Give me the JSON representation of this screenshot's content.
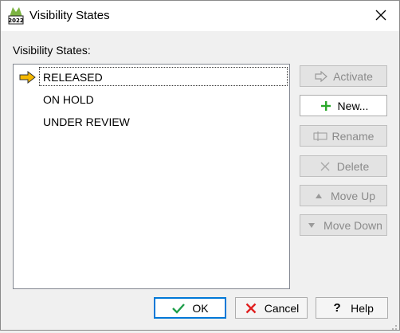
{
  "window": {
    "title": "Visibility States",
    "app_icon": "app-2022-icon",
    "close_icon": "close-icon"
  },
  "section_label": "Visibility States:",
  "states": [
    {
      "label": "RELEASED",
      "active": true,
      "selected": true
    },
    {
      "label": "ON HOLD",
      "active": false,
      "selected": false
    },
    {
      "label": "UNDER REVIEW",
      "active": false,
      "selected": false
    }
  ],
  "side_buttons": {
    "activate": {
      "label": "Activate",
      "icon": "arrow-right-icon",
      "enabled": false
    },
    "new": {
      "label": "New...",
      "icon": "plus-icon",
      "enabled": true
    },
    "rename": {
      "label": "Rename",
      "icon": "rename-icon",
      "enabled": false
    },
    "delete": {
      "label": "Delete",
      "icon": "x-icon",
      "enabled": false
    },
    "move_up": {
      "label": "Move Up",
      "icon": "triangle-up-icon",
      "enabled": false
    },
    "move_down": {
      "label": "Move Down",
      "icon": "triangle-down-icon",
      "enabled": false
    }
  },
  "footer_buttons": {
    "ok": {
      "label": "OK",
      "icon": "checkmark-icon"
    },
    "cancel": {
      "label": "Cancel",
      "icon": "x-icon"
    },
    "help": {
      "label": "Help",
      "icon": "question-icon"
    }
  },
  "colors": {
    "active_arrow": "#f5b800",
    "ok_check": "#1e9e4a",
    "cancel_x": "#e02020",
    "new_plus": "#2aa82a",
    "default_border": "#0078d7"
  }
}
